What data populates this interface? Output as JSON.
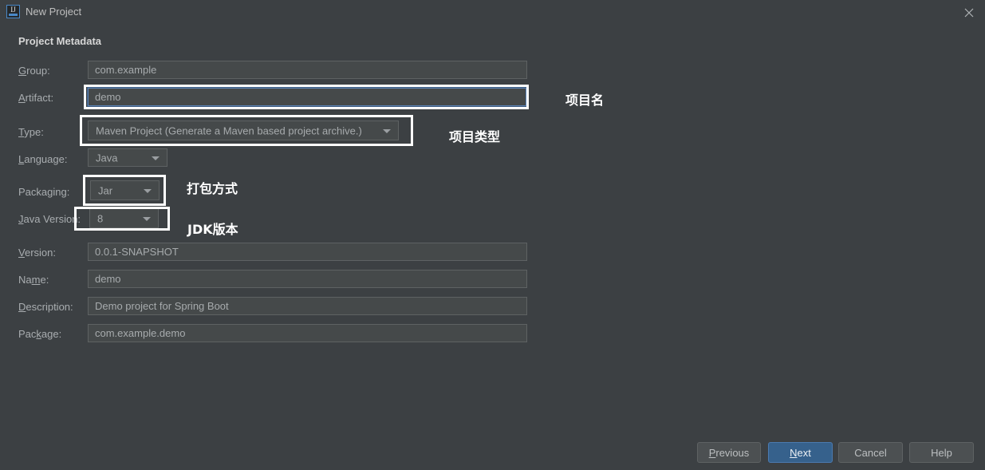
{
  "window": {
    "title": "New Project",
    "app_icon": "intellij-idea-icon",
    "icon_letters": "IJ",
    "close_icon": "close-icon"
  },
  "section": {
    "heading": "Project Metadata"
  },
  "form": {
    "group": {
      "label_pre": "G",
      "label_mnemonic": "",
      "label": "Group:",
      "value": "com.example"
    },
    "artifact": {
      "label": "Artifact:",
      "value": "demo"
    },
    "type": {
      "label": "Type:",
      "value": "Maven Project",
      "value_hint": "(Generate a Maven based project archive.)"
    },
    "language": {
      "label": "Language:",
      "value": "Java"
    },
    "packaging": {
      "label": "Packaging:",
      "value": "Jar"
    },
    "java_version": {
      "label": "Java Version:",
      "value": "8"
    },
    "version": {
      "label": "Version:",
      "value": "0.0.1-SNAPSHOT"
    },
    "name": {
      "label": "Name:",
      "value": "demo"
    },
    "description": {
      "label": "Description:",
      "value": "Demo project for Spring Boot"
    },
    "package": {
      "label": "Package:",
      "value": "com.example.demo"
    }
  },
  "annotations": [
    {
      "text": "项目名"
    },
    {
      "text": "项目类型"
    },
    {
      "text": "打包方式"
    },
    {
      "text": "JDK版本"
    }
  ],
  "footer": {
    "previous": "Previous",
    "next": "Next",
    "cancel": "Cancel",
    "help": "Help"
  },
  "colors": {
    "background": "#3c4043",
    "field_background": "#45494a",
    "accent_blue": "#36618c",
    "focus_blue": "#5c85b8",
    "annotation_white": "#ffffff"
  }
}
